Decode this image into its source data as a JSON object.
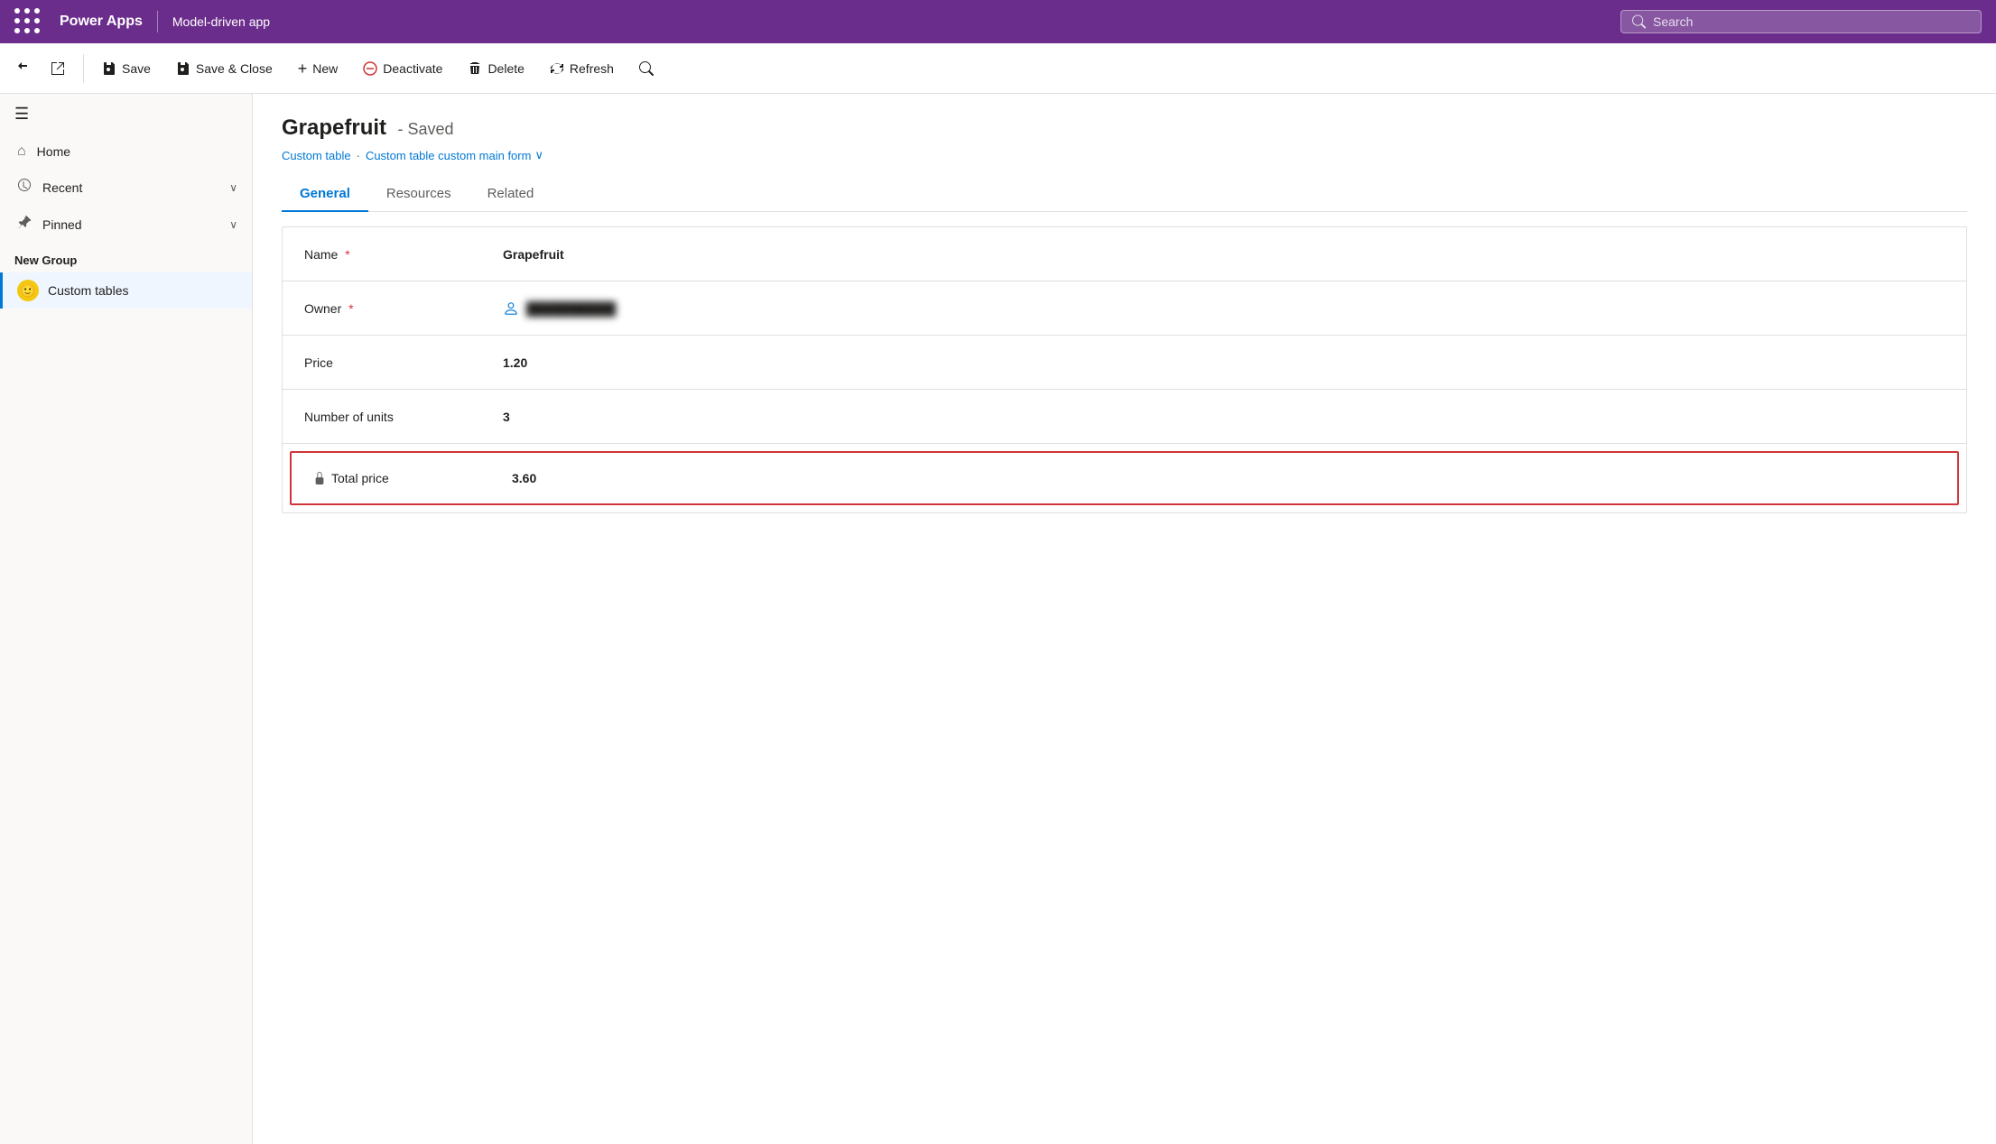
{
  "topBar": {
    "logoText": "Power Apps",
    "appName": "Model-driven app",
    "searchPlaceholder": "Search"
  },
  "commandBar": {
    "backButton": "←",
    "popoutLabel": "⤢",
    "saveLabel": "Save",
    "saveCloseLabel": "Save & Close",
    "newLabel": "New",
    "deactivateLabel": "Deactivate",
    "deleteLabel": "Delete",
    "refreshLabel": "Refresh",
    "searchLabel": "🔍"
  },
  "sidebar": {
    "hamburger": "☰",
    "navItems": [
      {
        "label": "Home",
        "icon": "⌂"
      },
      {
        "label": "Recent",
        "icon": "🕐",
        "hasChevron": true
      },
      {
        "label": "Pinned",
        "icon": "📌",
        "hasChevron": true
      }
    ],
    "groupLabel": "New Group",
    "tableItem": {
      "label": "Custom tables",
      "iconEmoji": "🙂"
    }
  },
  "record": {
    "title": "Grapefruit",
    "status": "- Saved",
    "breadcrumbTable": "Custom table",
    "breadcrumbForm": "Custom table custom main form",
    "tabs": [
      {
        "label": "General",
        "active": true
      },
      {
        "label": "Resources",
        "active": false
      },
      {
        "label": "Related",
        "active": false
      }
    ],
    "fields": [
      {
        "label": "Name",
        "required": true,
        "value": "Grapefruit",
        "type": "text"
      },
      {
        "label": "Owner",
        "required": true,
        "value": "██████████",
        "type": "owner"
      },
      {
        "label": "Price",
        "required": false,
        "value": "1.20",
        "type": "text"
      },
      {
        "label": "Number of units",
        "required": false,
        "value": "3",
        "type": "text"
      },
      {
        "label": "Total price",
        "required": false,
        "value": "3.60",
        "type": "locked",
        "locked": true
      }
    ]
  }
}
